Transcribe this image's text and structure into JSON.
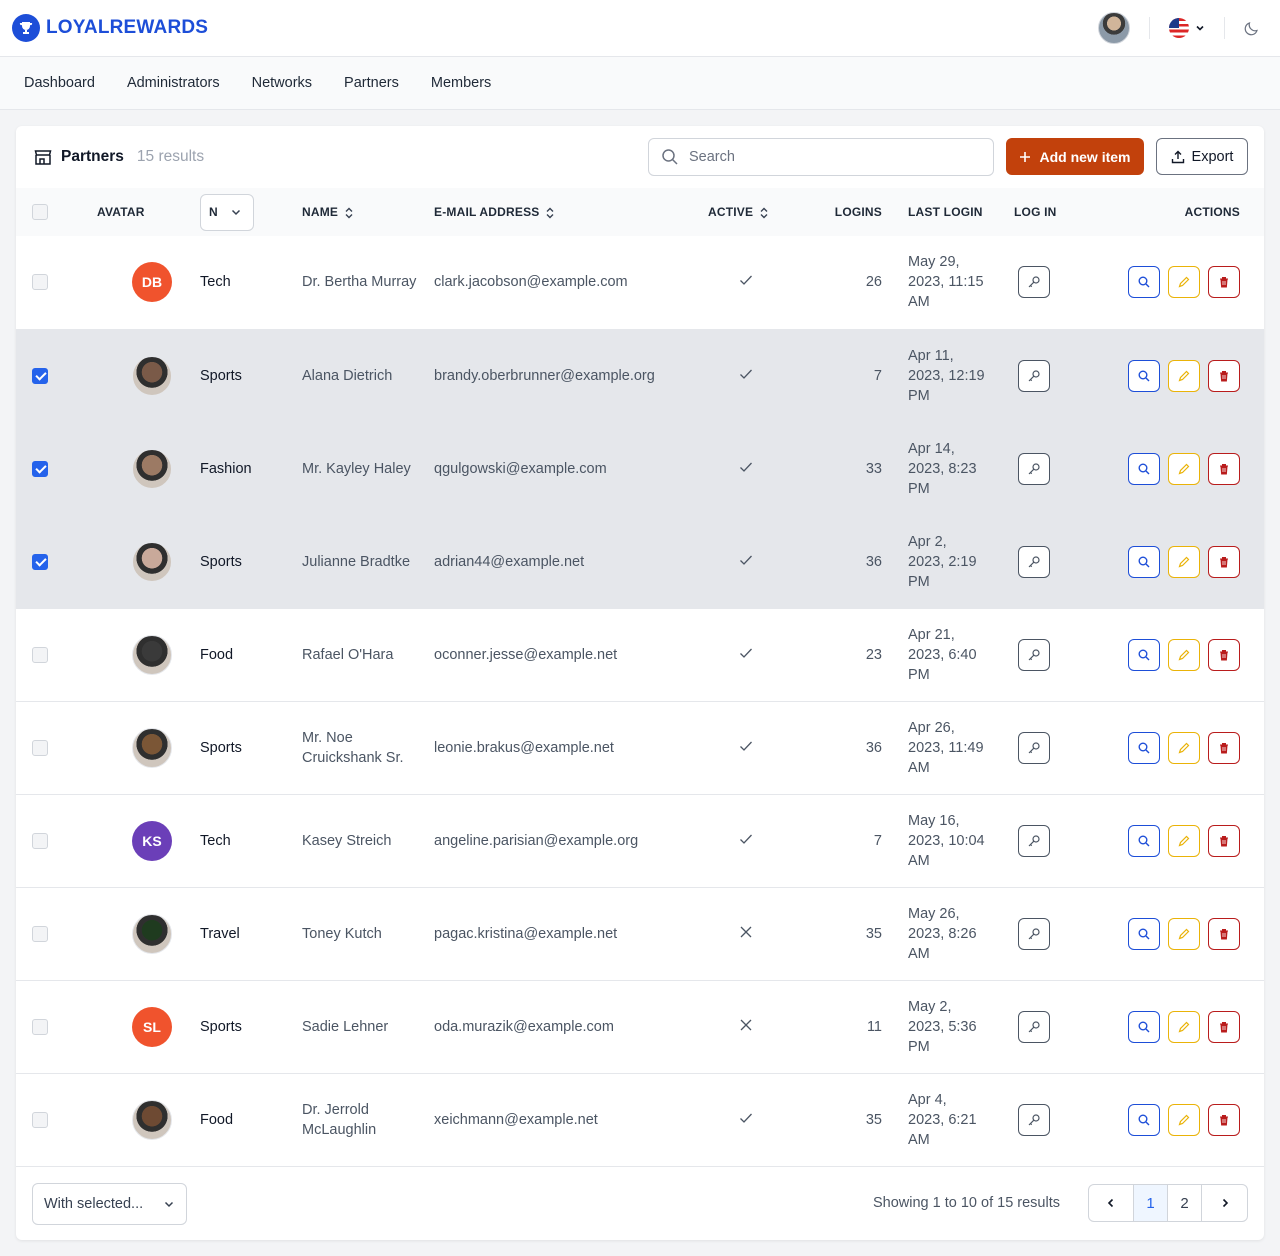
{
  "brand": {
    "name_part1": "LOYAL",
    "name_part2": "REWARDS",
    "color": "#1d4ed8"
  },
  "nav": [
    "Dashboard",
    "Administrators",
    "Networks",
    "Partners",
    "Members"
  ],
  "page": {
    "title": "Partners",
    "result_count": "15 results"
  },
  "search": {
    "placeholder": "Search",
    "value": ""
  },
  "buttons": {
    "add": "Add new item",
    "export": "Export"
  },
  "columns": {
    "avatar": "AVATAR",
    "network_filter": "N",
    "name": "NAME",
    "email": "E-MAIL ADDRESS",
    "active": "ACTIVE",
    "logins": "LOGINS",
    "last_login": "LAST LOGIN",
    "log_in": "LOG IN",
    "actions": "ACTIONS"
  },
  "rows": [
    {
      "selected": false,
      "avatar_initials": "DB",
      "avatar_color": "#f0532d",
      "avatar_photo": false,
      "network": "Tech",
      "name": "Dr. Bertha Murray",
      "email": "clark.jacobson@example.com",
      "active": true,
      "logins": "26",
      "last_login": "May 29, 2023, 11:15 AM"
    },
    {
      "selected": true,
      "avatar_initials": "",
      "avatar_color": "#7a5a48",
      "avatar_photo": true,
      "network": "Sports",
      "name": "Alana Dietrich",
      "email": "brandy.oberbrunner@example.org",
      "active": true,
      "logins": "7",
      "last_login": "Apr 11, 2023, 12:19 PM"
    },
    {
      "selected": true,
      "avatar_initials": "",
      "avatar_color": "#9c7a64",
      "avatar_photo": true,
      "network": "Fashion",
      "name": "Mr. Kayley Haley",
      "email": "qgulgowski@example.com",
      "active": true,
      "logins": "33",
      "last_login": "Apr 14, 2023, 8:23 PM"
    },
    {
      "selected": true,
      "avatar_initials": "",
      "avatar_color": "#c9a99a",
      "avatar_photo": true,
      "network": "Sports",
      "name": "Julianne Bradtke",
      "email": "adrian44@example.net",
      "active": true,
      "logins": "36",
      "last_login": "Apr 2, 2023, 2:19 PM"
    },
    {
      "selected": false,
      "avatar_initials": "",
      "avatar_color": "#3a3a3a",
      "avatar_photo": true,
      "network": "Food",
      "name": "Rafael O'Hara",
      "email": "oconner.jesse@example.net",
      "active": true,
      "logins": "23",
      "last_login": "Apr 21, 2023, 6:40 PM"
    },
    {
      "selected": false,
      "avatar_initials": "",
      "avatar_color": "#7b5636",
      "avatar_photo": true,
      "network": "Sports",
      "name": "Mr. Noe Cruickshank Sr.",
      "email": "leonie.brakus@example.net",
      "active": true,
      "logins": "36",
      "last_login": "Apr 26, 2023, 11:49 AM"
    },
    {
      "selected": false,
      "avatar_initials": "KS",
      "avatar_color": "#6b3fb8",
      "avatar_photo": false,
      "network": "Tech",
      "name": "Kasey Streich",
      "email": "angeline.parisian@example.org",
      "active": true,
      "logins": "7",
      "last_login": "May 16, 2023, 10:04 AM"
    },
    {
      "selected": false,
      "avatar_initials": "",
      "avatar_color": "#1f3b1f",
      "avatar_photo": true,
      "network": "Travel",
      "name": "Toney Kutch",
      "email": "pagac.kristina@example.net",
      "active": false,
      "logins": "35",
      "last_login": "May 26, 2023, 8:26 AM"
    },
    {
      "selected": false,
      "avatar_initials": "SL",
      "avatar_color": "#f0532d",
      "avatar_photo": false,
      "network": "Sports",
      "name": "Sadie Lehner",
      "email": "oda.murazik@example.com",
      "active": false,
      "logins": "11",
      "last_login": "May 2, 2023, 5:36 PM"
    },
    {
      "selected": false,
      "avatar_initials": "",
      "avatar_color": "#6e4a33",
      "avatar_photo": true,
      "network": "Food",
      "name": "Dr. Jerrold McLaughlin",
      "email": "xeichmann@example.net",
      "active": true,
      "logins": "35",
      "last_login": "Apr 4, 2023, 6:21 AM"
    }
  ],
  "footer": {
    "bulk_select": "With selected...",
    "showing": "Showing 1 to 10 of 15 results",
    "pages": [
      "1",
      "2"
    ],
    "current_page": "1"
  },
  "colors": {
    "accent": "#c2410c",
    "primary": "#1d4ed8",
    "edit": "#eab308",
    "danger": "#b91c1c"
  }
}
